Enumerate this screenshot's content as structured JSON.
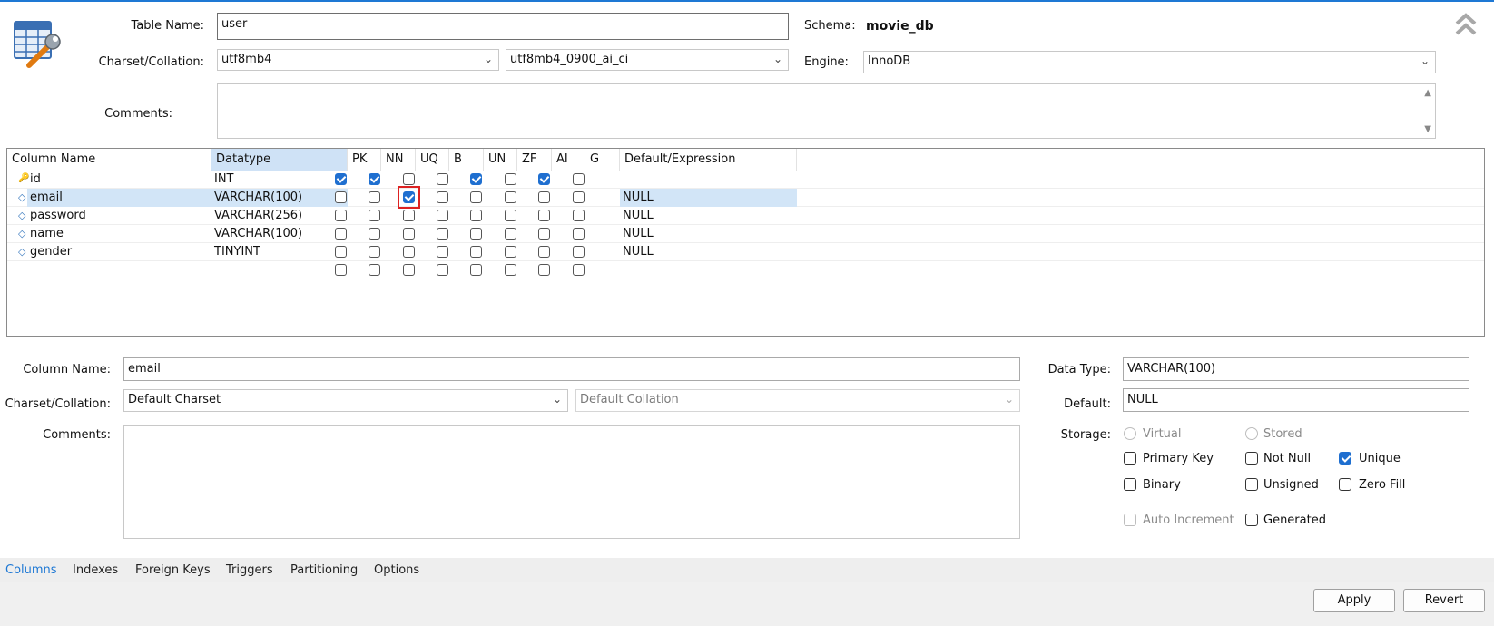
{
  "header": {
    "table_name_label": "Table Name:",
    "table_name_value": "user",
    "schema_label": "Schema:",
    "schema_value": "movie_db",
    "charset_label": "Charset/Collation:",
    "charset_value": "utf8mb4",
    "collation_value": "utf8mb4_0900_ai_ci",
    "engine_label": "Engine:",
    "engine_value": "InnoDB",
    "comments_label": "Comments:",
    "collapse_icon": "double-chevron-up-icon",
    "table_icon": "table-wrench-icon"
  },
  "grid": {
    "headers": [
      "Column Name",
      "Datatype",
      "PK",
      "NN",
      "UQ",
      "B",
      "UN",
      "ZF",
      "AI",
      "G",
      "Default/Expression"
    ],
    "rows": [
      {
        "name": "id",
        "type": "INT",
        "icon": "key-icon",
        "flags": [
          1,
          1,
          0,
          0,
          1,
          0,
          1,
          0
        ],
        "default": ""
      },
      {
        "name": "email",
        "type": "VARCHAR(100)",
        "icon": "diamond-icon",
        "flags": [
          0,
          0,
          1,
          0,
          0,
          0,
          0,
          0
        ],
        "default": "NULL"
      },
      {
        "name": "password",
        "type": "VARCHAR(256)",
        "icon": "diamond-icon",
        "flags": [
          0,
          0,
          0,
          0,
          0,
          0,
          0,
          0
        ],
        "default": "NULL"
      },
      {
        "name": "name",
        "type": "VARCHAR(100)",
        "icon": "diamond-icon",
        "flags": [
          0,
          0,
          0,
          0,
          0,
          0,
          0,
          0
        ],
        "default": "NULL"
      },
      {
        "name": "gender",
        "type": "TINYINT",
        "icon": "diamond-icon",
        "flags": [
          0,
          0,
          0,
          0,
          0,
          0,
          0,
          0
        ],
        "default": "NULL"
      },
      {
        "name": "",
        "type": "",
        "icon": "",
        "flags": [
          0,
          0,
          0,
          0,
          0,
          0,
          0,
          0
        ],
        "default": ""
      }
    ]
  },
  "details": {
    "column_name_label": "Column Name:",
    "column_name_value": "email",
    "charset_label": "Charset/Collation:",
    "charset_value": "Default Charset",
    "collation_value": "Default Collation",
    "comments_label": "Comments:",
    "datatype_label": "Data Type:",
    "datatype_value": "VARCHAR(100)",
    "default_label": "Default:",
    "default_value": "NULL",
    "storage_label": "Storage:",
    "virtual_label": "Virtual",
    "stored_label": "Stored",
    "primary_key_label": "Primary Key",
    "not_null_label": "Not Null",
    "unique_label": "Unique",
    "binary_label": "Binary",
    "unsigned_label": "Unsigned",
    "zero_fill_label": "Zero Fill",
    "auto_increment_label": "Auto Increment",
    "generated_label": "Generated"
  },
  "tabs": [
    "Columns",
    "Indexes",
    "Foreign Keys",
    "Triggers",
    "Partitioning",
    "Options"
  ],
  "buttons": {
    "apply": "Apply",
    "revert": "Revert"
  },
  "colors": {
    "accent": "#1e78d4",
    "checked": "#1f6fd0",
    "selection": "#d2e5f7",
    "highlight": "#dd2222"
  }
}
